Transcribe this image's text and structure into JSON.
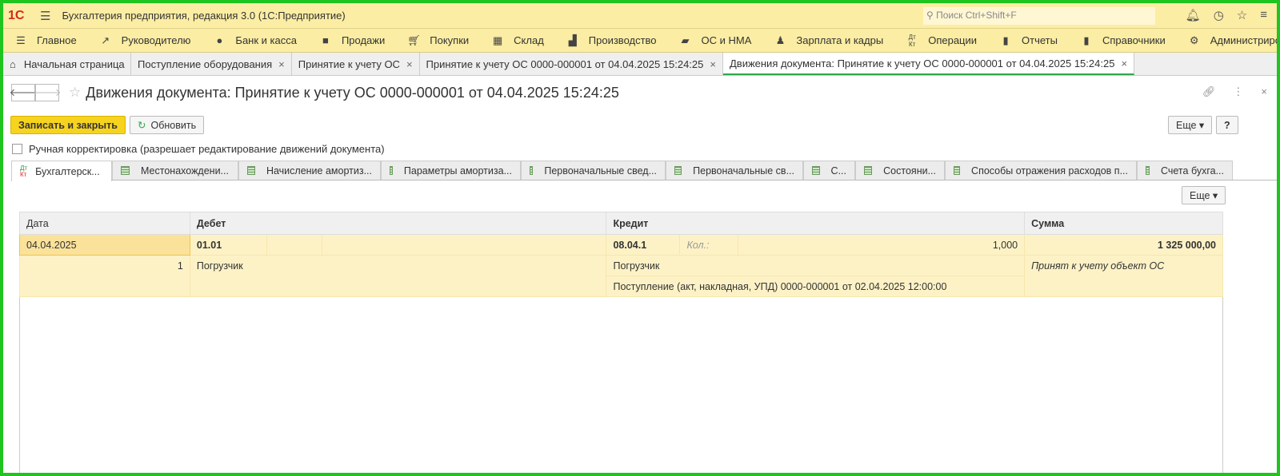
{
  "app": {
    "title": "Бухгалтерия предприятия, редакция 3.0  (1С:Предприятие)",
    "search_placeholder": "Поиск Ctrl+Shift+F"
  },
  "menu": [
    "Главное",
    "Руководителю",
    "Банк и касса",
    "Продажи",
    "Покупки",
    "Склад",
    "Производство",
    "ОС и НМА",
    "Зарплата и кадры",
    "Операции",
    "Отчеты",
    "Справочники",
    "Администриров"
  ],
  "tabs": [
    "Начальная страница",
    "Поступление оборудования",
    "Принятие к учету ОС",
    "Принятие к учету ОС 0000-000001 от 04.04.2025 15:24:25",
    "Движения документа: Принятие к учету ОС 0000-000001 от 04.04.2025 15:24:25"
  ],
  "page": {
    "title": "Движения документа: Принятие к учету ОС 0000-000001 от 04.04.2025 15:24:25",
    "save_close": "Записать и закрыть",
    "refresh": "Обновить",
    "more": "Еще",
    "help": "?",
    "manual": "Ручная корректировка (разрешает редактирование движений документа)"
  },
  "form_tabs": [
    "Бухгалтерск...",
    "Местонахождени...",
    "Начисление амортиз...",
    "Параметры амортиза...",
    "Первоначальные свед...",
    "Первоначальные св...",
    "С...",
    "Состояни...",
    "Способы отражения расходов п...",
    "Счета бухга..."
  ],
  "table": {
    "headers": [
      "Дата",
      "Дебет",
      "Кредит",
      "Сумма"
    ],
    "row": {
      "date": "04.04.2025",
      "num": "1",
      "debit": "01.01",
      "debit_sub": "Погрузчик",
      "credit": "08.04.1",
      "qty_label": "Кол.:",
      "qty": "1,000",
      "credit_sub1": "Погрузчик",
      "credit_sub2": "Поступление (акт, накладная, УПД) 0000-000001 от 02.04.2025 12:00:00",
      "sum": "1 325 000,00",
      "content": "Принят к учету объект ОС"
    }
  }
}
